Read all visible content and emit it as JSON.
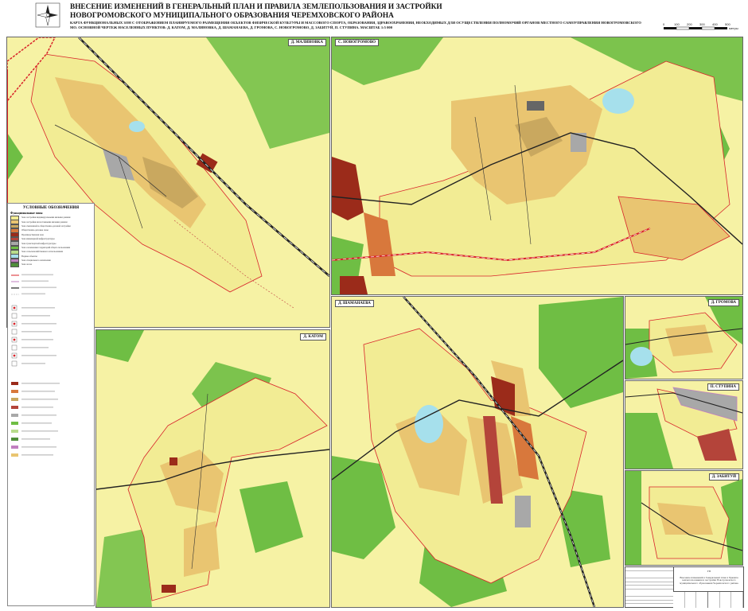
{
  "header": {
    "title": "ВНЕСЕНИЕ ИЗМЕНЕНИЙ В ГЕНЕРАЛЬНЫЙ ПЛАН И ПРАВИЛА ЗЕМЛЕПОЛЬЗОВАНИЯ И ЗАСТРОЙКИ НОВОГРОМОВСКОГО МУНИЦИПАЛЬНОГО ОБРАЗОВАНИЯ ЧЕРЕМХОВСКОГО РАЙОНА",
    "subtitle": "КАРТА ФУНКЦИОНАЛЬНЫХ ЗОН С ОТОБРАЖЕНИЕМ ПЛАНИРУЕМОГО РАЗМЕЩЕНИЯ ОБЪЕКТОВ ФИЗИЧЕСКОЙ КУЛЬТУРЫ И МАССОВОГО СПОРТА, ОБРАЗОВАНИЯ, ЗДРАВООХРАНЕНИЯ, НЕОБХОДИМЫХ ДЛЯ ОСУЩЕСТВЛЕНИЯ ПОЛНОМОЧИЙ ОРГАНОВ МЕСТНОГО САМОУПРАВЛЕНИЯ НОВОГРОМОВСКОГО МО. ОСНОВНОЙ ЧЕРТЕЖ НАСЕЛЕННЫХ ПУНКТОВ: Д. КАТОМ, Д. МАЛИНОВКА, Д. ШАМАНАЕВА, Д. ГРОМОВА, С. НОВОГРОМОВО, Д. ЗАБИТУЙ, П. СТУПИНА. МАСШТАБ 1:5 000",
    "scale_ticks": [
      "0",
      "100",
      "200",
      "300",
      "400",
      "500"
    ],
    "scale_unit": "метры"
  },
  "panels": {
    "malinovka": "Д. МАЛИНОВКА",
    "novogromovo": "С. НОВОГРОМОВО",
    "katom": "Д. КАТОМ",
    "shamanaeva": "Д. ШАМАНАЕВА",
    "gromova": "Д. ГРОМОВА",
    "stupina": "П. СТУПИНА",
    "zabituy": "Д. ЗАБИТУЙ"
  },
  "legend": {
    "title": "УСЛОВНЫЕ ОБОЗНАЧЕНИЯ",
    "sections": [
      {
        "heading": "Функциональные зоны",
        "items": [
          {
            "color": "#f2ec94",
            "text": "Зона застройки индивидуальными жилыми домами"
          },
          {
            "color": "#e9c571",
            "text": "Зона застройки малоэтажными жилыми домами"
          },
          {
            "color": "#c9a85f",
            "text": "Зона смешанной и общественно-деловой застройки"
          },
          {
            "color": "#d8783c",
            "text": "Общественно-деловые зоны"
          },
          {
            "color": "#9b2b1a",
            "text": "Производственная зона"
          },
          {
            "color": "#b4443a",
            "text": "Зона инженерной инфраструктуры"
          },
          {
            "color": "#a8a8a8",
            "text": "Зона транспортной инфраструктуры"
          },
          {
            "color": "#6fbe44",
            "text": "Зона озелененных территорий общего пользования"
          },
          {
            "color": "#b8dc8c",
            "text": "Зона сельскохозяйственного использования"
          },
          {
            "color": "#a6e0ec",
            "text": "Водные объекты"
          },
          {
            "color": "#c17fc0",
            "text": "Зона специального назначения"
          },
          {
            "color": "#4f8f3a",
            "text": "Зона лесов"
          }
        ]
      }
    ]
  },
  "stamp": {
    "sheet": "ГП",
    "text": "Внесение изменений в Генеральный план и Правила землепользования и застройки Новогромовского муниципального образования Черемховского района"
  },
  "colors": {
    "field": "#f6f2a4",
    "forest": "#6fbe44",
    "residential": "#e9c571",
    "public": "#c9a85f",
    "industrial": "#9b2b1a",
    "water": "#a6e0ec",
    "border": "#d8232a",
    "road": "#222222"
  }
}
